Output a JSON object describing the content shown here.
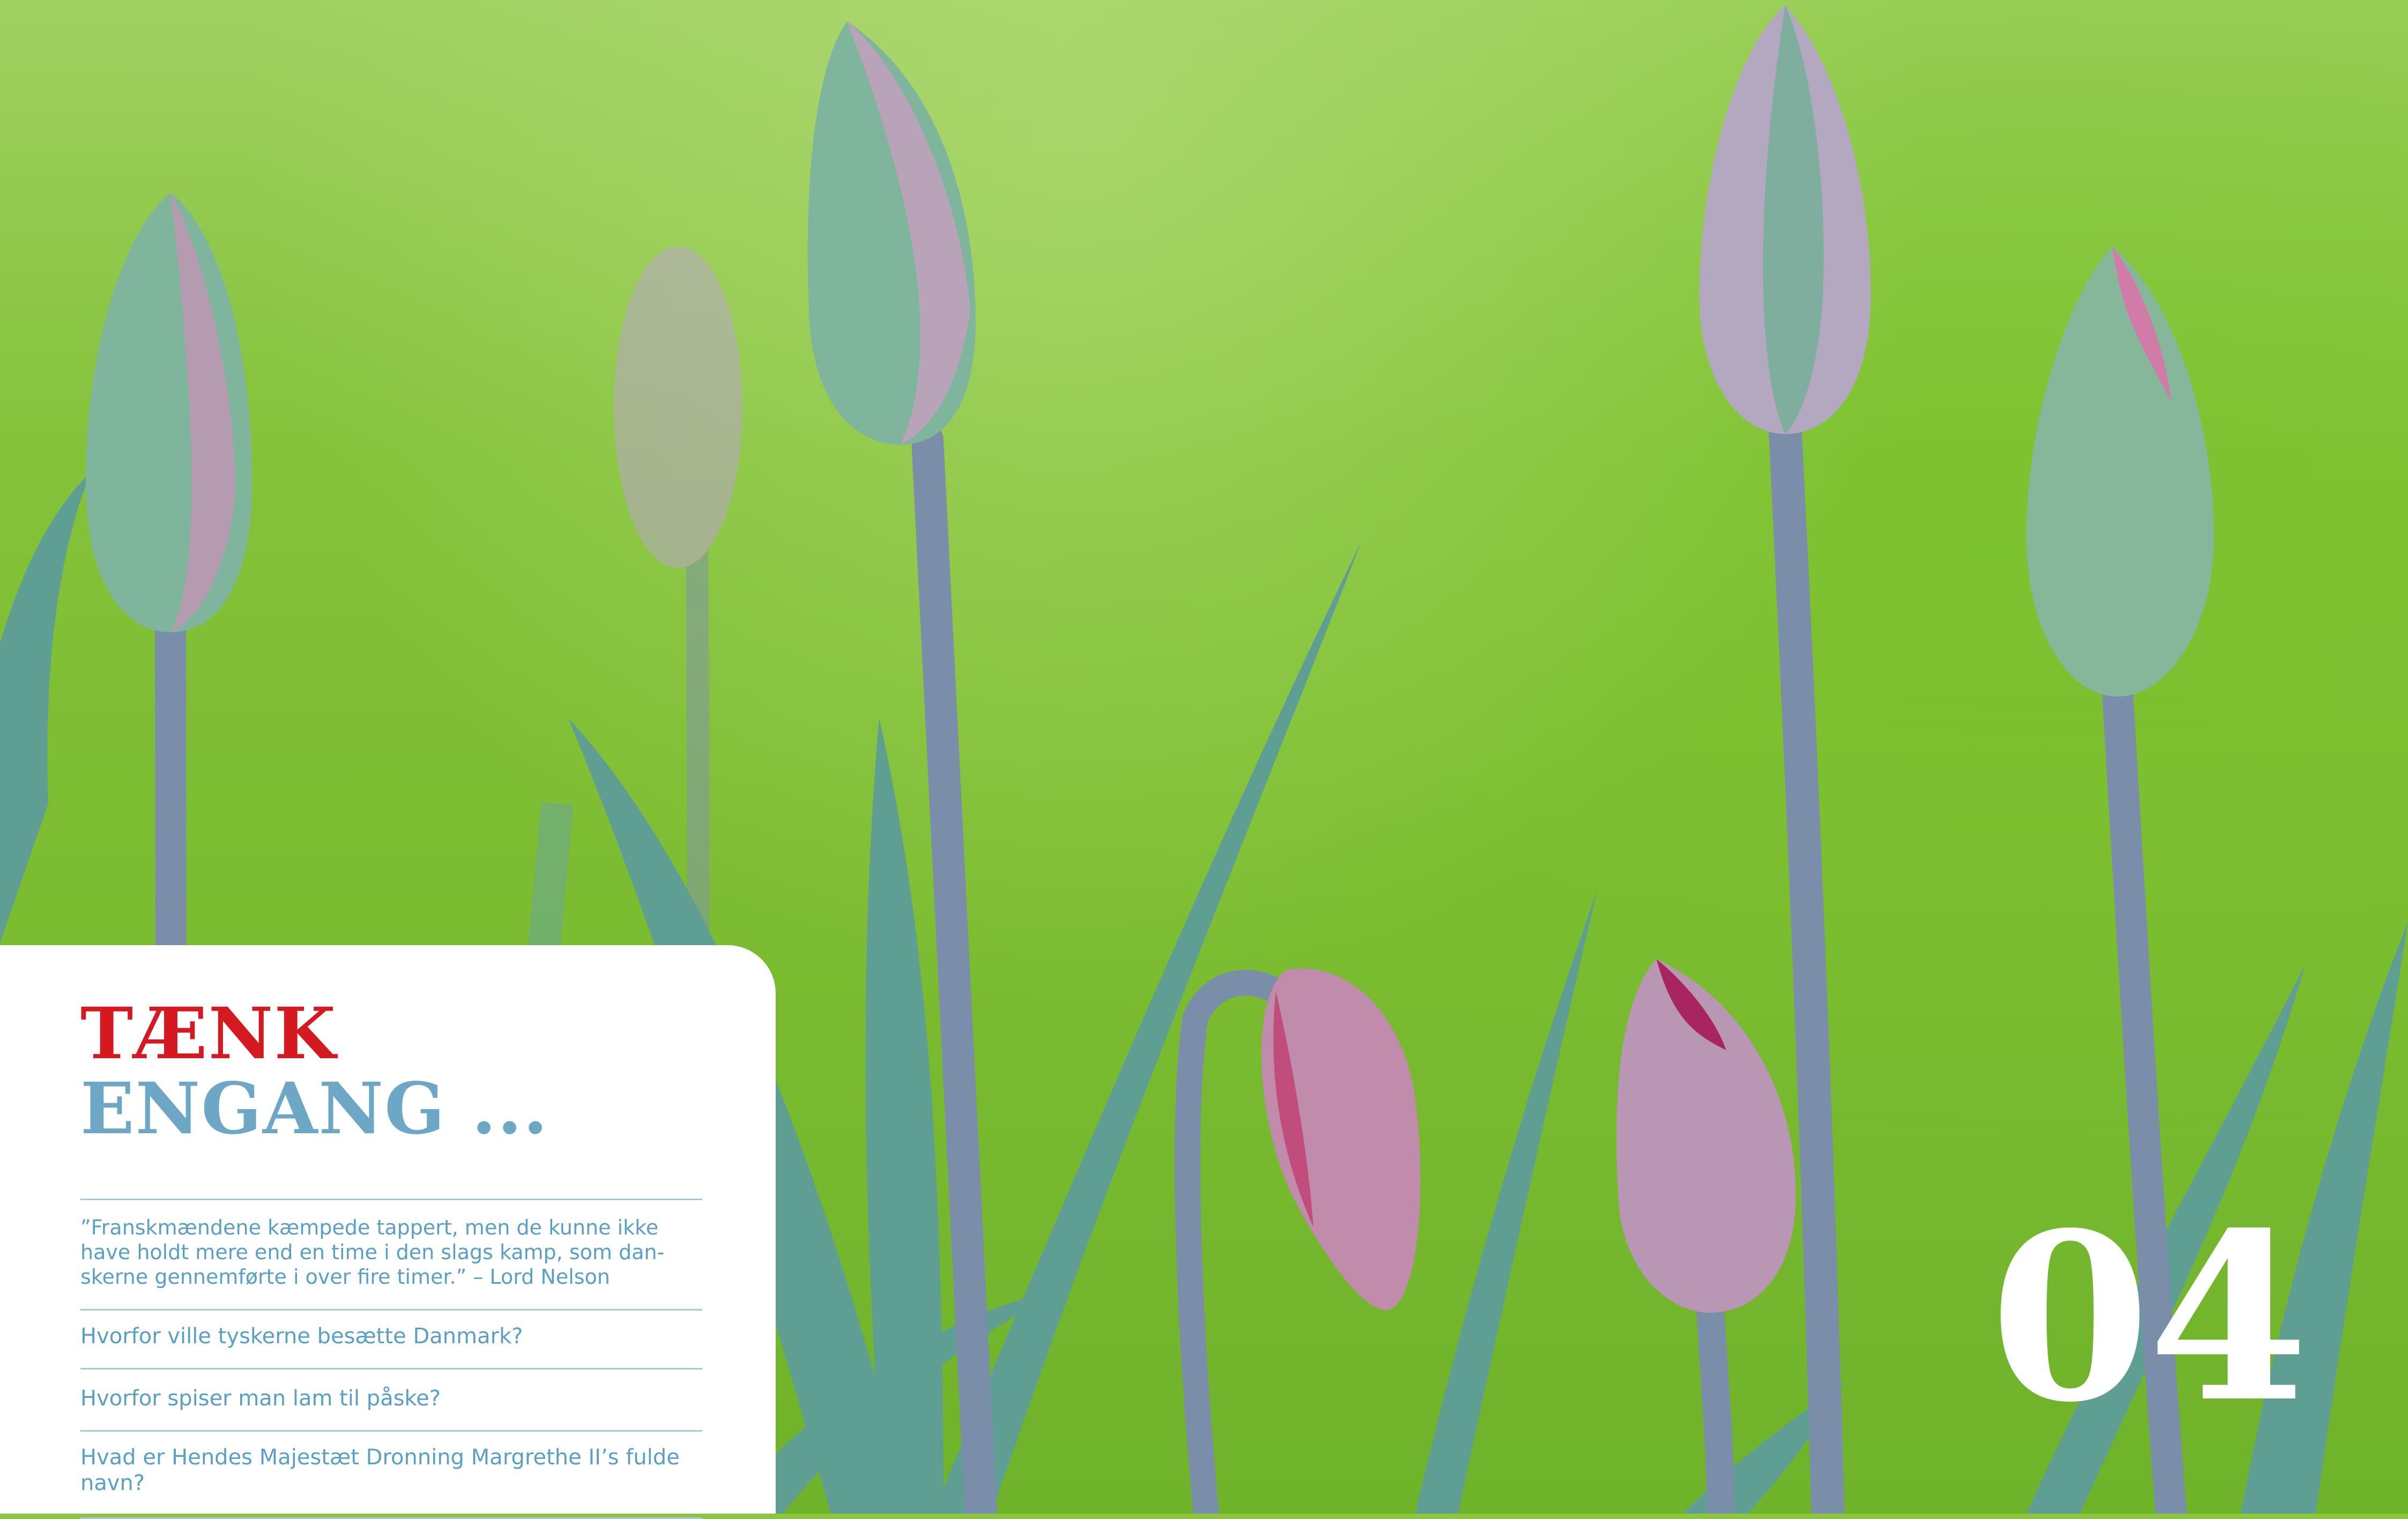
{
  "heading": {
    "line1": "TÆNK",
    "line2": "ENGANG ..."
  },
  "items": [
    "”Franskmændene kæmpede tappert, men de kunne ikke have holdt mere end en time i den slags kamp, som dan-skerne gennemførte i over fire timer.” – Lord Nelson",
    "Hvorfor ville tyskerne besætte Danmark?",
    "Hvorfor spiser man lam til påske?",
    "Hvad er Hendes Majestæt Dronning Margrethe II’s fulde navn?"
  ],
  "page_number": "04",
  "colors": {
    "heading_red": "#d41920",
    "heading_blue": "#6ea7c6",
    "text_blue": "#5aa0c3",
    "background_green": "#7dbd32"
  }
}
